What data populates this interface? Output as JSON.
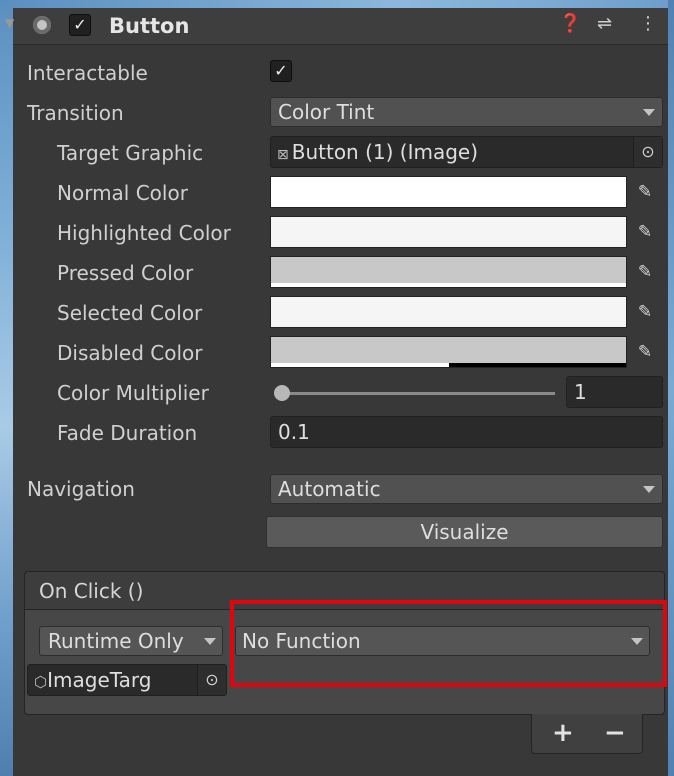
{
  "header": {
    "title": "Button",
    "enabled": true,
    "icons": [
      "help-icon",
      "preset-icon",
      "menu-icon"
    ]
  },
  "fields": {
    "interactable": {
      "label": "Interactable",
      "checked": true
    },
    "transition": {
      "label": "Transition",
      "value": "Color Tint"
    },
    "target_graphic": {
      "label": "Target Graphic",
      "value": "Button (1) (Image)"
    },
    "normal_color": {
      "label": "Normal Color",
      "color": "#ffffff"
    },
    "highlighted_color": {
      "label": "Highlighted Color",
      "color": "#f5f5f5"
    },
    "pressed_color": {
      "label": "Pressed Color",
      "color": "#c8c8c8"
    },
    "selected_color": {
      "label": "Selected Color",
      "color": "#f5f5f5"
    },
    "disabled_color": {
      "label": "Disabled Color",
      "color": "#c8c8c8",
      "alpha_fraction": 0.5
    },
    "color_multiplier": {
      "label": "Color Multiplier",
      "value": "1",
      "slider_fraction": 0.0
    },
    "fade_duration": {
      "label": "Fade Duration",
      "value": "0.1"
    },
    "navigation": {
      "label": "Navigation",
      "value": "Automatic"
    },
    "visualize": {
      "label": "Visualize"
    }
  },
  "on_click": {
    "title": "On Click ()",
    "runtime": "Runtime Only",
    "function": "No Function",
    "target": "ImageTarg",
    "add_label": "+",
    "remove_label": "−"
  },
  "highlight_color": "#e0060e"
}
